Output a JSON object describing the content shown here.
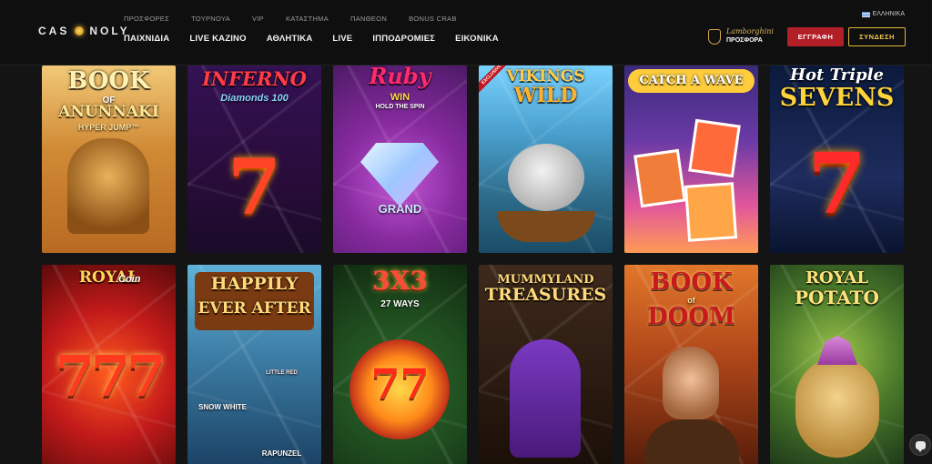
{
  "header": {
    "logo_text_left": "CAS",
    "logo_text_right": "NOLY",
    "top_links": [
      "ΠΡΟΣΦΟΡΕΣ",
      "ΤΟΥΡΝΟΥΑ",
      "VIP",
      "ΚΑΤΑΣΤΗΜΑ",
      "ΠΑΝΘΕΟΝ",
      "BONUS CRAB"
    ],
    "main_links": [
      "ΠΑΙΧΝΙΔΙΑ",
      "LIVE ΚΑΖΙΝΟ",
      "ΑΘΛΗΤΙΚΑ",
      "LIVE",
      "ΙΠΠΟΔΡΟΜΙΕΣ",
      "ΕΙΚΟΝΙΚΑ"
    ],
    "language": "ΕΛΛΗΝΙΚΑ",
    "promo_brand": "Lamborghini",
    "promo_label": "ΠΡΟΣΦΟΡΑ",
    "register_label": "ΕΓΓΡΑΦΗ",
    "login_label": "ΣΥΝΔΕΣΗ"
  },
  "games": [
    {
      "title": "BOOK",
      "sub1": "OF",
      "sub2": "ANUNNAKI",
      "sub3": "HYPER JUMP™"
    },
    {
      "title": "INFERNO",
      "sub1": "Diamonds 100"
    },
    {
      "title": "Ruby",
      "sub1": "WIN",
      "sub2": "HOLD THE SPIN",
      "sub3": "GRAND"
    },
    {
      "title": "VIKINGS",
      "sub1": "WILD",
      "badge": "EXCLUSIVE"
    },
    {
      "title": "CATCH A WAVE"
    },
    {
      "title": "Hot Triple",
      "sub1": "SEVENS"
    },
    {
      "title": "ROYAL",
      "sub1": "Coin"
    },
    {
      "title": "HAPPILY",
      "sub1": "EVER AFTER",
      "sub2": "SNOW WHITE",
      "sub3": "RAPUNZEL",
      "sub4": "LITTLE RED"
    },
    {
      "title": "3X3",
      "sub1": "27 WAYS"
    },
    {
      "title": "MUMMYLAND",
      "sub1": "TREASURES"
    },
    {
      "title": "BOOK",
      "sub1": "of",
      "sub2": "DOOM"
    },
    {
      "title": "ROYAL",
      "sub1": "POTATO"
    }
  ],
  "colors": {
    "accent_red": "#b21f27",
    "accent_gold": "#e1b73b",
    "background": "#141414"
  },
  "icons": {
    "chat": "chat-bubble-icon",
    "promo": "lamborghini-bull-icon",
    "flag": "greek-flag-icon"
  }
}
